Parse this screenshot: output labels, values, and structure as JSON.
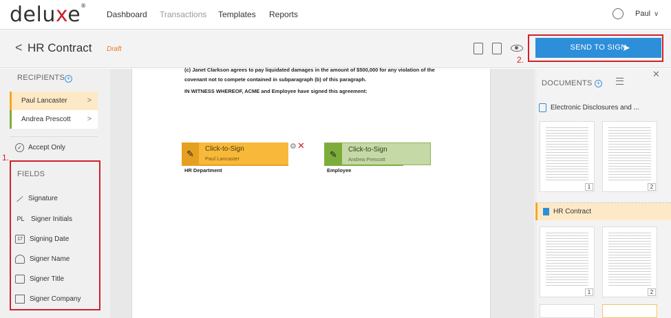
{
  "brand": {
    "name_a": "delu",
    "name_x": "x",
    "name_b": "e",
    "reg": "®"
  },
  "nav": {
    "items": [
      {
        "label": "Dashboard",
        "muted": false
      },
      {
        "label": "Transactions",
        "muted": true
      },
      {
        "label": "Templates",
        "muted": false
      },
      {
        "label": "Reports",
        "muted": false
      }
    ],
    "user": "Paul"
  },
  "titlebar": {
    "back": "<",
    "title": "HR Contract",
    "status": "Draft",
    "send_label": "SEND TO SIGN"
  },
  "callouts": {
    "one": "1.",
    "two": "2."
  },
  "recipients": {
    "label": "RECIPIENTS",
    "items": [
      {
        "name": "Paul Lancaster"
      },
      {
        "name": "Andrea Prescott"
      }
    ]
  },
  "accept_only": "Accept Only",
  "fields": {
    "label": "FIELDS",
    "items": [
      {
        "label": "Signature",
        "icon": "pen-icon"
      },
      {
        "label": "Signer Initials",
        "icon": "initials-icon",
        "glyph": "PL"
      },
      {
        "label": "Signing Date",
        "icon": "calendar-icon",
        "glyph": "17"
      },
      {
        "label": "Signer Name",
        "icon": "person-icon"
      },
      {
        "label": "Signer Title",
        "icon": "id-card-icon"
      },
      {
        "label": "Signer Company",
        "icon": "building-icon"
      }
    ]
  },
  "document": {
    "para_line1": "(c) Janet Clarkson agrees to pay liquidated damages in the amount of $500,000 for any violation of the",
    "para_line2": "covenant not to compete contained in subparagraph (b) of this paragraph.",
    "witness": "IN WITNESS WHEREOF, ACME and Employee have signed this agreement:",
    "sig_fields": [
      {
        "label": "Click-to-Sign",
        "signer": "Paul Lancaster",
        "caption": "HR Department"
      },
      {
        "label": "Click-to-Sign",
        "signer": "Andrea Prescott",
        "caption": "Employee"
      }
    ]
  },
  "documents_panel": {
    "label": "DOCUMENTS",
    "items": [
      {
        "name": "Electronic Disclosures and ...",
        "pages": [
          "1",
          "2"
        ]
      },
      {
        "name": "HR Contract",
        "pages": [
          "1",
          "2"
        ]
      }
    ]
  },
  "colors": {
    "accent": "#2d8fd9",
    "signer1": "#f8b83a",
    "signer2": "#7cad3a",
    "callout": "#d0202a"
  }
}
